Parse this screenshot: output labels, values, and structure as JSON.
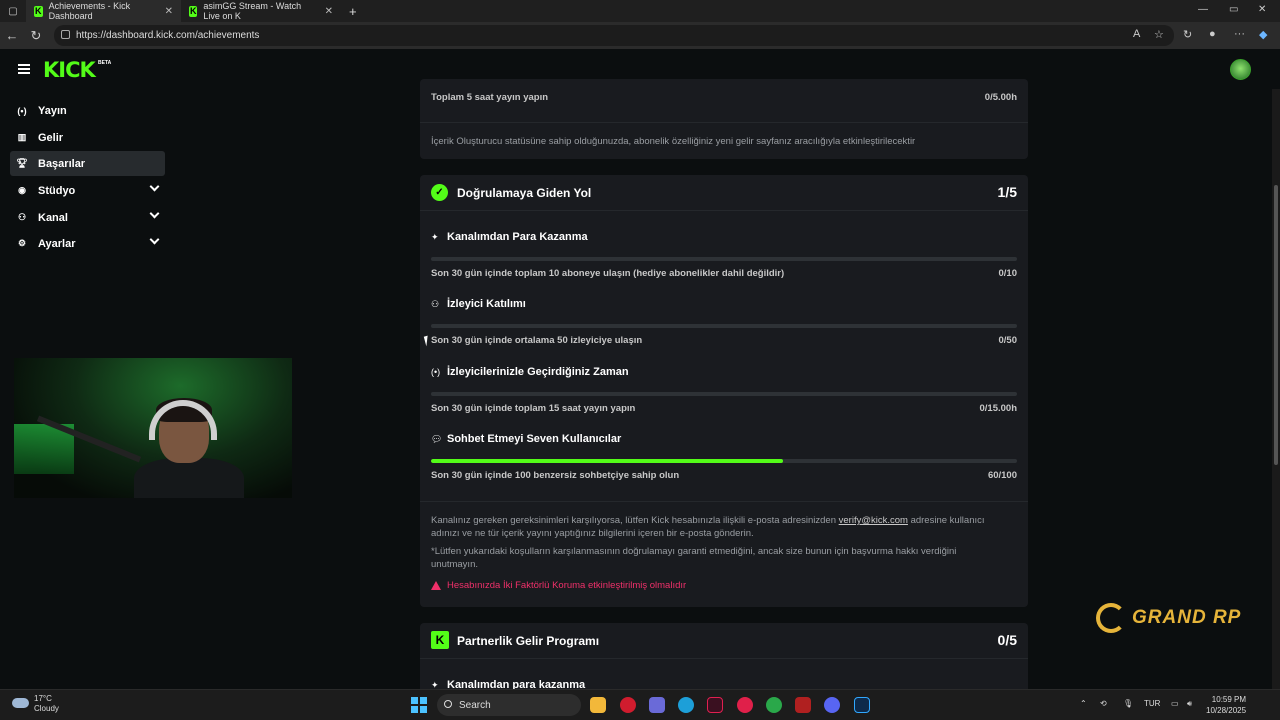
{
  "browser": {
    "tabs": [
      {
        "title": "Achievements - Kick Dashboard",
        "active": true
      },
      {
        "title": "asimGG Stream - Watch Live on K",
        "active": false
      }
    ],
    "url": "https://dashboard.kick.com/achievements",
    "new_tab": "+"
  },
  "header": {
    "logo": "KICK",
    "beta": "BETA"
  },
  "sidebar": {
    "items": [
      {
        "label": "Yayın",
        "icon": "broadcast-icon"
      },
      {
        "label": "Gelir",
        "icon": "revenue-icon"
      },
      {
        "label": "Başarılar",
        "icon": "trophy-icon",
        "active": true
      },
      {
        "label": "Stüdyo",
        "icon": "studio-icon",
        "expandable": true
      },
      {
        "label": "Kanal",
        "icon": "channel-icon",
        "expandable": true
      },
      {
        "label": "Ayarlar",
        "icon": "settings-icon",
        "expandable": true
      }
    ]
  },
  "partial_card": {
    "task_text": "Toplam 5 saat yayın yapın",
    "task_value": "0/5.00h",
    "note": "İçerik Oluşturucu statüsüne sahip olduğunuzda, abonelik özelliğiniz yeni gelir sayfanız aracılığıyla etkinleştirilecektir"
  },
  "verification": {
    "title": "Doğrulamaya Giden Yol",
    "count": "1/5",
    "tasks": [
      {
        "title": "Kanalımdan Para Kazanma",
        "icon": "sparkle-icon",
        "text": "Son 30 gün içinde toplam 10 aboneye ulaşın (hediye abonelikler dahil değildir)",
        "value": "0/10",
        "progress": 0
      },
      {
        "title": "İzleyici Katılımı",
        "icon": "viewers-icon",
        "text": "Son 30 gün içinde ortalama 50 izleyiciye ulaşın",
        "value": "0/50",
        "progress": 0
      },
      {
        "title": "İzleyicilerinizle Geçirdiğiniz Zaman",
        "icon": "broadcast-icon",
        "text": "Son 30 gün içinde toplam 15 saat yayın yapın",
        "value": "0/15.00h",
        "progress": 0
      },
      {
        "title": "Sohbet Etmeyi Seven Kullanıcılar",
        "icon": "chat-icon",
        "text": "Son 30 gün içinde 100 benzersiz sohbetçiye sahip olun",
        "value": "60/100",
        "progress": 0.6
      }
    ],
    "note_part1": "Kanalınız gereken gereksinimleri karşılıyorsa, lütfen Kick hesabınızla ilişkili e-posta adresinizden",
    "note_email": "verify@kick.com",
    "note_part2": "adresine kullanıcı",
    "note_line2": "adınızı ve ne tür içerik yayını yaptığınız bilgilerini içeren bir e-posta gönderin.",
    "disclaimer_line1": "*Lütfen yukarıdaki koşulların karşılanmasının doğrulamayı garanti etmediğini, ancak size bunun için başvurma hakkı verdiğini",
    "disclaimer_line2": "unutmayın.",
    "warning": "Hesabınızda İki Faktörlü Koruma etkinleştirilmiş olmalıdır"
  },
  "partner": {
    "title": "Partnerlik Gelir Programı",
    "count": "0/5",
    "first_task": "Kanalımdan para kazanma"
  },
  "watermark": "GRAND RP",
  "taskbar": {
    "temperature": "17°C",
    "weather": "Cloudy",
    "search": "Search",
    "language": "TUR",
    "time": "10:59 PM",
    "date": "10/28/2025"
  },
  "colors": {
    "accent": "#53fc18",
    "warning": "#f0306a",
    "card": "#191b1f"
  }
}
